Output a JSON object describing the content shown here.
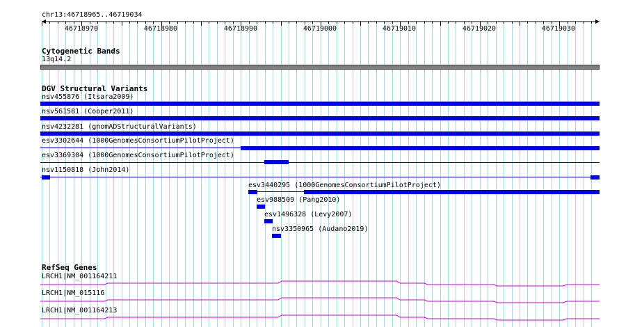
{
  "ruler": {
    "position": "chr13:46718965..46719034",
    "ticks": [
      "46718970",
      "46718980",
      "46718990",
      "46719000",
      "46719010",
      "46719020",
      "46719030"
    ]
  },
  "cytoband": {
    "title": "Cytogenetic Bands",
    "band": "13q14.2"
  },
  "dgv": {
    "title": "DGV Structural Variants",
    "features": [
      "nsv455876 (Itsara2009)",
      "nsv561581 (Cooper2011)",
      "nsv4232281 (gnomADStructuralVariants)",
      "esv3302644 (1000GenomesConsortiumPilotProject)",
      "esv3369304 (1000GenomesConsortiumPilotProject)",
      "nsv1150818 (John2014)",
      "esv3440295 (1000GenomesConsortiumPilotProject)",
      "esv988509 (Pang2010)",
      "esv1496328 (Levy2007)",
      "nsv3350965 (Audano2019)"
    ]
  },
  "refseq": {
    "title": "RefSeq Genes",
    "genes": [
      "LRCH1|NM_001164211",
      "LRCH1|NM_015116",
      "LRCH1|NM_001164213"
    ]
  },
  "colors": {
    "grid": "#a8d8e8",
    "variant": "#0000e6",
    "gene": "#cc00cc",
    "cytoband": "#808080"
  }
}
